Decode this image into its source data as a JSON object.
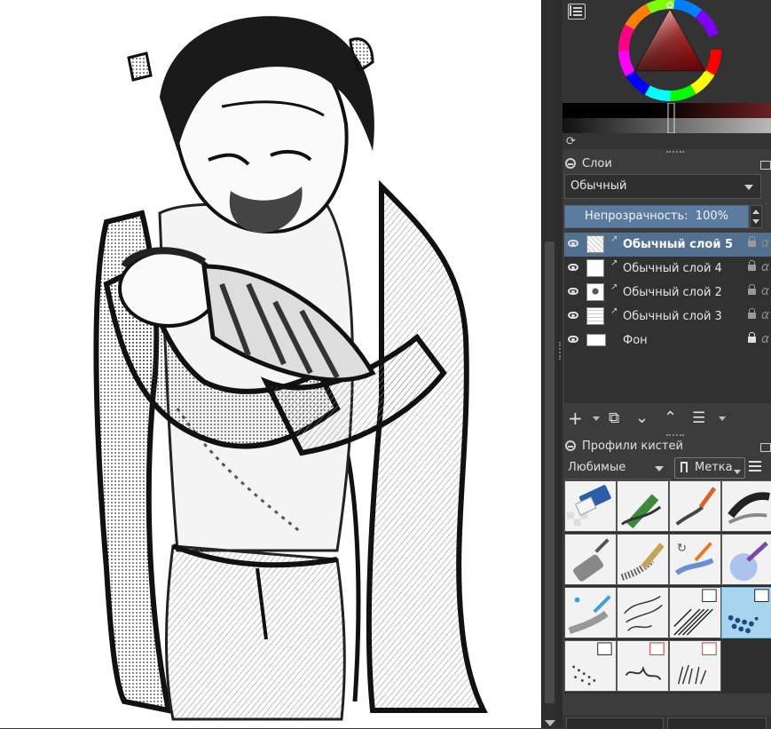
{
  "layers_docker": {
    "title": "Слои",
    "blend_mode": "Обычный",
    "opacity_label": "Непрозрачность:",
    "opacity_value": "100%",
    "layers": [
      {
        "name": "Обычный слой 5",
        "active": true,
        "locked": false
      },
      {
        "name": "Обычный слой 4",
        "active": false,
        "locked": false
      },
      {
        "name": "Обычный слой 2",
        "active": false,
        "locked": false
      },
      {
        "name": "Обычный слой 3",
        "active": false,
        "locked": false
      },
      {
        "name": "Фон",
        "active": false,
        "locked": true
      }
    ],
    "toolbar": {
      "add_icon": "plus-icon",
      "duplicate_icon": "duplicate-icon",
      "move_down_icon": "chevron-down-icon",
      "move_up_icon": "chevron-up-icon",
      "properties_icon": "sliders-icon"
    }
  },
  "brush_presets": {
    "title": "Профили кистей",
    "filter": "Любимые",
    "tag_label": "Метка",
    "presets": [
      {
        "name": "eraser",
        "icon": "eraser-preset-icon"
      },
      {
        "name": "pencil",
        "icon": "pencil-preset-icon"
      },
      {
        "name": "paint-brush",
        "icon": "brush-preset-icon"
      },
      {
        "name": "ink-brush",
        "icon": "ink-preset-icon"
      },
      {
        "name": "roller",
        "icon": "roller-preset-icon"
      },
      {
        "name": "wet-brush",
        "icon": "wet-brush-preset-icon"
      },
      {
        "name": "smudge-brush",
        "icon": "smudge-preset-icon"
      },
      {
        "name": "watercolor",
        "icon": "watercolor-preset-icon"
      },
      {
        "name": "blender",
        "icon": "blender-preset-icon"
      },
      {
        "name": "sketch-lines",
        "icon": "sketch-preset-icon"
      },
      {
        "name": "hatching",
        "icon": "hatching-preset-icon"
      },
      {
        "name": "halftone",
        "icon": "halftone-preset-icon"
      },
      {
        "name": "dots",
        "icon": "dots-preset-icon"
      },
      {
        "name": "splatter",
        "icon": "splatter-preset-icon"
      },
      {
        "name": "grass",
        "icon": "grass-preset-icon"
      }
    ]
  },
  "colors": {
    "accent": "#52708f",
    "opacity_bar": "#5b7c9e",
    "panel": "#3c3c3c",
    "selected_preset": "#a8d4ef"
  }
}
